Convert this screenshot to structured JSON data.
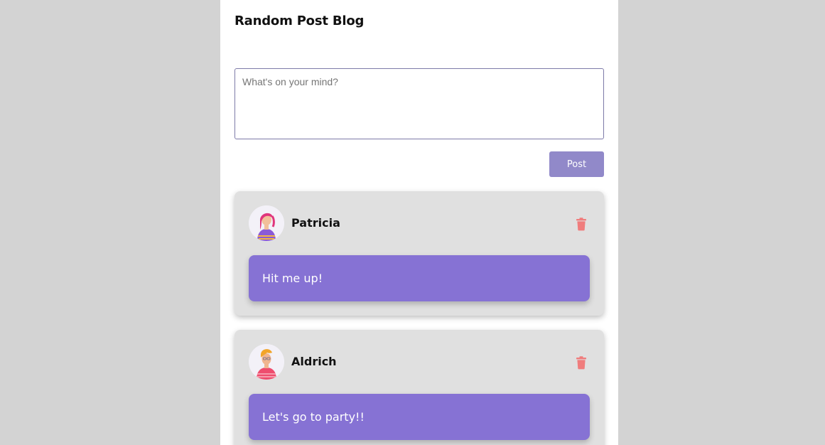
{
  "header": {
    "title": "Random Post Blog"
  },
  "composer": {
    "placeholder": "What's on your mind?",
    "value": "",
    "button_label": "Post"
  },
  "posts": [
    {
      "author": "Patricia",
      "message": "Hit me up!",
      "avatar_icon": "avatar-woman-pink-hair"
    },
    {
      "author": "Aldrich",
      "message": "Let's go to party!!",
      "avatar_icon": "avatar-man-orange-hair"
    }
  ],
  "icons": {
    "delete": "trash-icon"
  },
  "colors": {
    "page_background": "#d3d3d3",
    "content_background": "#ffffff",
    "accent": "#8672d4",
    "post_button": "#9189c9",
    "card_background": "#e0e0e0",
    "delete_icon": "#f07d7d"
  }
}
